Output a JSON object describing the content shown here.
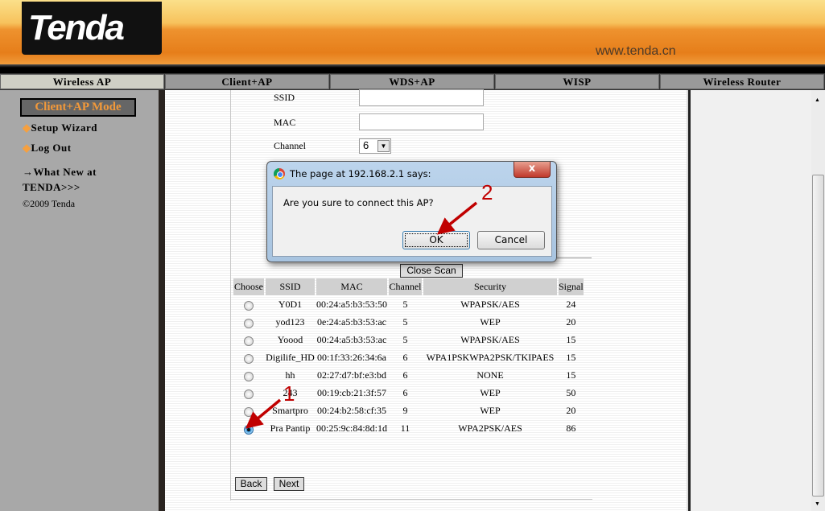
{
  "header": {
    "logo_text": "Tenda",
    "url": "www.tenda.cn"
  },
  "tabs": [
    {
      "label": "Wireless AP",
      "active": true
    },
    {
      "label": "Client+AP"
    },
    {
      "label": "WDS+AP"
    },
    {
      "label": "WISP"
    },
    {
      "label": "Wireless Router"
    }
  ],
  "sidebar": {
    "mode": "Client+AP Mode",
    "items": [
      {
        "label": "Setup Wizard"
      },
      {
        "label": "Log Out"
      }
    ],
    "whatsnew_line1": "→What New at",
    "whatsnew_line2": "TENDA>>>",
    "copyright": "©2009 Tenda"
  },
  "form": {
    "ssid_label": "SSID",
    "ssid_value": "",
    "mac_label": "MAC",
    "mac_value": "",
    "channel_label": "Channel",
    "channel_value": "6"
  },
  "scan": {
    "close_label": "Close Scan",
    "columns": [
      "Choose",
      "SSID",
      "MAC",
      "Channel",
      "Security",
      "Signal"
    ],
    "rows": [
      {
        "ssid": "Y0D1",
        "mac": "00:24:a5:b3:53:50",
        "channel": "5",
        "security": "WPAPSK/AES",
        "signal": "24",
        "selected": false
      },
      {
        "ssid": "yod123",
        "mac": "0e:24:a5:b3:53:ac",
        "channel": "5",
        "security": "WEP",
        "signal": "20",
        "selected": false
      },
      {
        "ssid": "Yoood",
        "mac": "00:24:a5:b3:53:ac",
        "channel": "5",
        "security": "WPAPSK/AES",
        "signal": "15",
        "selected": false
      },
      {
        "ssid": "Digilife_HD",
        "mac": "00:1f:33:26:34:6a",
        "channel": "6",
        "security": "WPA1PSKWPA2PSK/TKIPAES",
        "signal": "15",
        "selected": false
      },
      {
        "ssid": "hh",
        "mac": "02:27:d7:bf:e3:bd",
        "channel": "6",
        "security": "NONE",
        "signal": "15",
        "selected": false
      },
      {
        "ssid": "243",
        "mac": "00:19:cb:21:3f:57",
        "channel": "6",
        "security": "WEP",
        "signal": "50",
        "selected": false
      },
      {
        "ssid": "Smartpro",
        "mac": "00:24:b2:58:cf:35",
        "channel": "9",
        "security": "WEP",
        "signal": "20",
        "selected": false
      },
      {
        "ssid": "Pra Pantip",
        "mac": "00:25:9c:84:8d:1d",
        "channel": "11",
        "security": "WPA2PSK/AES",
        "signal": "86",
        "selected": true
      }
    ]
  },
  "buttons": {
    "back": "Back",
    "next": "Next"
  },
  "dialog": {
    "title": "The page at 192.168.2.1 says:",
    "message": "Are you sure to connect this AP?",
    "ok": "OK",
    "cancel": "Cancel",
    "close": "x"
  },
  "annotations": {
    "one": "1",
    "two": "2",
    "color": "#c00000"
  }
}
